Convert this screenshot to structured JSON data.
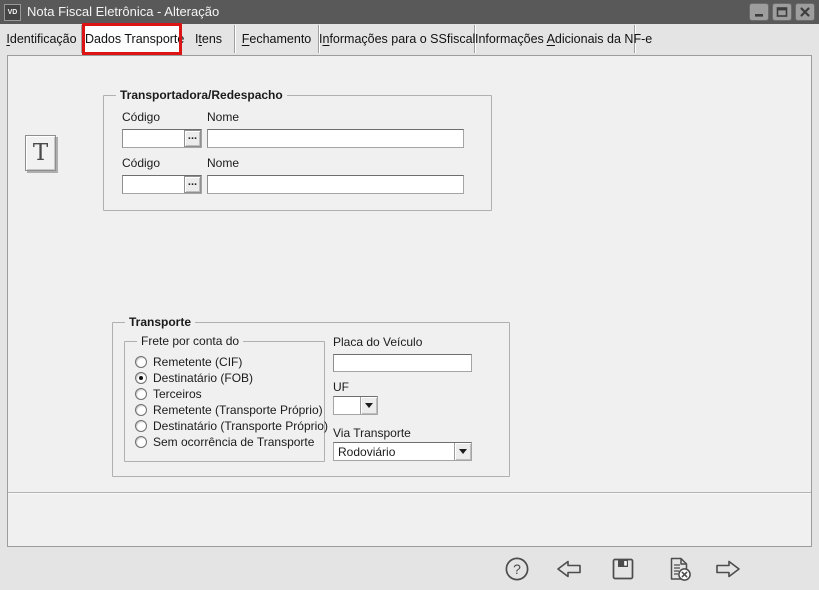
{
  "window": {
    "title": "Nota Fiscal Eletrônica - Alteração",
    "app_icon_text": "VD",
    "controls": {
      "minimize": "minimize",
      "maximize": "maximize",
      "close": "close"
    }
  },
  "colors": {
    "titlebar": "#595959",
    "annotation_red": "#dd1414",
    "panel_bg": "#f0f0f0"
  },
  "tabs": [
    {
      "pre": "",
      "key": "I",
      "post": "dentificação",
      "active": false
    },
    {
      "pre": "Dados Transporte",
      "key": "",
      "post": "",
      "active": true
    },
    {
      "pre": "I",
      "key": "t",
      "post": "ens",
      "active": false
    },
    {
      "pre": "",
      "key": "F",
      "post": "echamento",
      "active": false
    },
    {
      "pre": "I",
      "key": "n",
      "post": "formações para o SSfiscal",
      "active": false
    },
    {
      "pre": "Informações ",
      "key": "A",
      "post": "dicionais da NF-e",
      "active": false
    }
  ],
  "t_button_label": "T",
  "transportadora_group": {
    "title": "Transportadora/Redespacho",
    "rows": [
      {
        "codigo_label": "Código",
        "codigo_value": "",
        "browse_label": "...",
        "nome_label": "Nome",
        "nome_value": ""
      },
      {
        "codigo_label": "Código",
        "codigo_value": "",
        "browse_label": "...",
        "nome_label": "Nome",
        "nome_value": ""
      }
    ]
  },
  "transporte_group": {
    "title": "Transporte",
    "frete_group": {
      "title": "Frete por conta do",
      "options": [
        {
          "label": "Remetente (CIF)",
          "selected": false
        },
        {
          "label": "Destinatário (FOB)",
          "selected": true
        },
        {
          "label": "Terceiros",
          "selected": false
        },
        {
          "label": "Remetente (Transporte Próprio)",
          "selected": false
        },
        {
          "label": "Destinatário (Transporte Próprio)",
          "selected": false
        },
        {
          "label": "Sem ocorrência de Transporte",
          "selected": false
        }
      ]
    },
    "placa": {
      "label": "Placa do Veículo",
      "value": ""
    },
    "uf": {
      "label": "UF",
      "value": ""
    },
    "via": {
      "label": "Via Transporte",
      "value": "Rodoviário"
    }
  },
  "toolbar": {
    "icons": [
      "help",
      "back",
      "save",
      "cancel-document",
      "forward"
    ]
  }
}
